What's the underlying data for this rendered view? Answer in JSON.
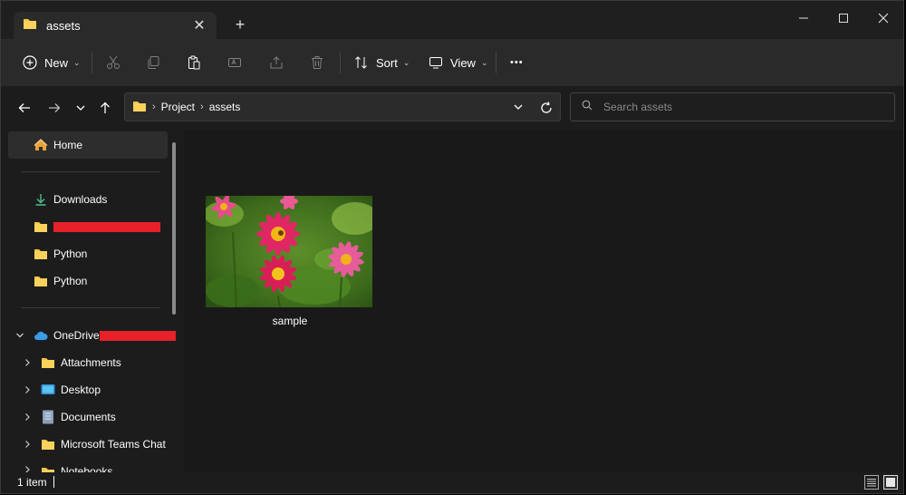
{
  "tab": {
    "title": "assets",
    "close": "✕",
    "new_tab": "+"
  },
  "window_controls": {
    "minimize": "—",
    "maximize": "▢",
    "close": "✕"
  },
  "toolbar": {
    "new_label": "New",
    "sort_label": "Sort",
    "view_label": "View",
    "more": "•••"
  },
  "breadcrumb": [
    "Project",
    "assets"
  ],
  "search": {
    "placeholder": "Search assets"
  },
  "sidebar": {
    "home": "Home",
    "pinned": [
      {
        "label": "Downloads",
        "icon": "download-icon"
      },
      {
        "label": "",
        "icon": "folder-icon",
        "redacted": true
      },
      {
        "label": "Python",
        "icon": "folder-icon"
      },
      {
        "label": "Python",
        "icon": "folder-icon"
      }
    ],
    "onedrive": {
      "label": "OneDrive",
      "redacted_suffix": true
    },
    "onedrive_children": [
      {
        "label": "Attachments",
        "icon": "folder-icon"
      },
      {
        "label": "Desktop",
        "icon": "desktop-icon"
      },
      {
        "label": "Documents",
        "icon": "documents-icon"
      },
      {
        "label": "Microsoft Teams Chat Fi",
        "icon": "folder-icon"
      },
      {
        "label": "Notebooks",
        "icon": "folder-icon"
      }
    ]
  },
  "files": [
    {
      "name": "sample",
      "type": "image"
    }
  ],
  "status": {
    "count": "1 item"
  },
  "colors": {
    "folder": "#f6c344",
    "accent_red": "#e8202a",
    "onedrive": "#3a9be6"
  }
}
